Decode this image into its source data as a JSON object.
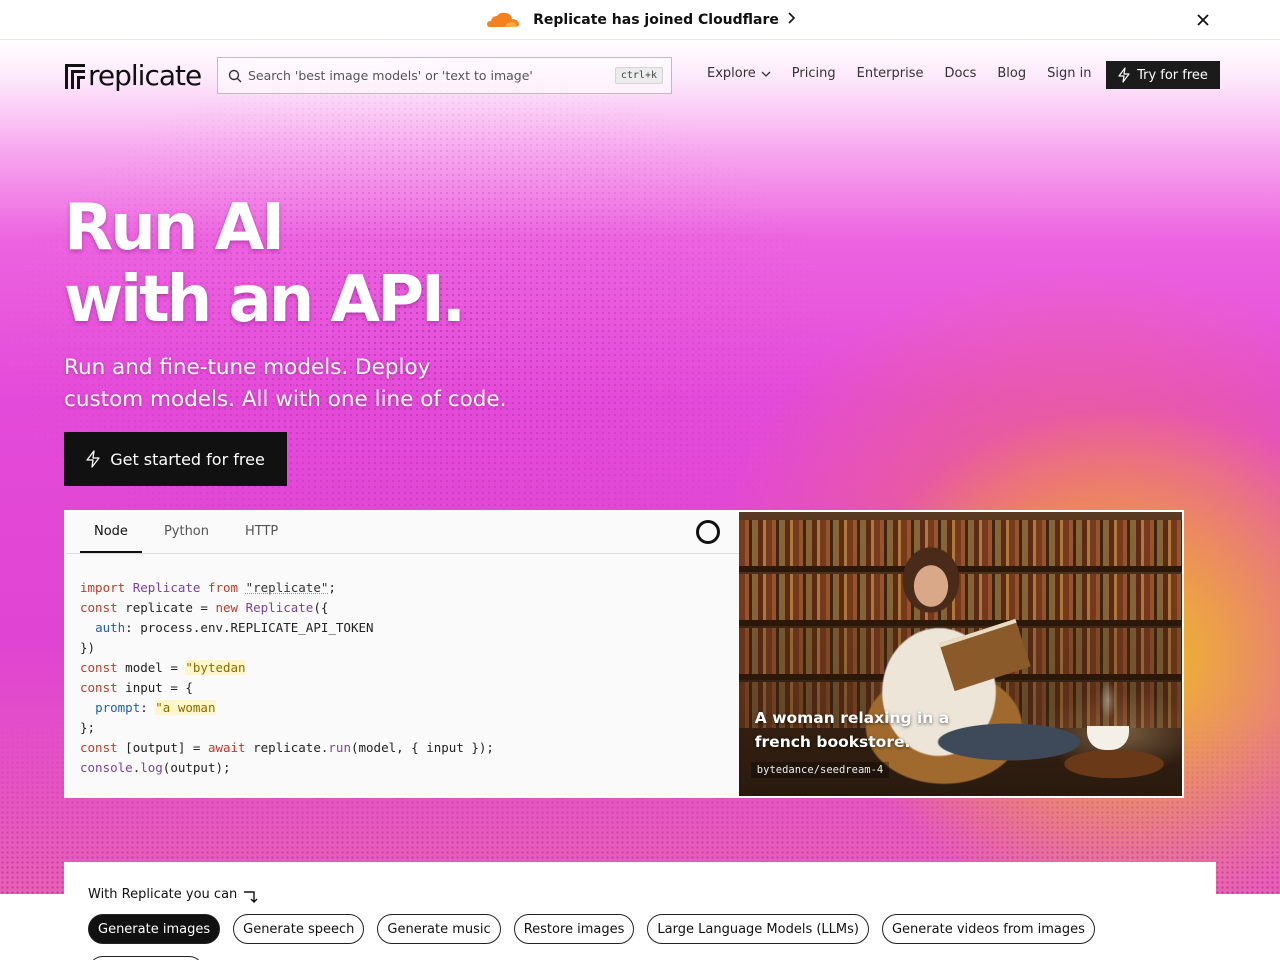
{
  "announcement": {
    "text": "Replicate has joined Cloudflare",
    "brand_color": "#f48120"
  },
  "nav": {
    "logo_text": "replicate",
    "search": {
      "placeholder": "Search 'best image models' or 'text to image'",
      "shortcut": "ctrl+k"
    },
    "links": [
      "Explore",
      "Pricing",
      "Enterprise",
      "Docs",
      "Blog",
      "Sign in"
    ],
    "try_label": "Try for free"
  },
  "hero": {
    "title_line1": "Run AI",
    "title_line2": "with an API.",
    "subtitle_line1": "Run and fine-tune models. Deploy",
    "subtitle_line2": "custom models. All with one line of code.",
    "cta_label": "Get started for free"
  },
  "code_panel": {
    "tabs": [
      "Node",
      "Python",
      "HTTP"
    ],
    "active_tab": "Node",
    "lines": {
      "l1_kw": "import",
      "l1_cls": "Replicate",
      "l1_from": "from",
      "l1_str": "\"replicate\"",
      "l1_end": ";",
      "l2_kw": "const",
      "l2_var": " replicate = ",
      "l2_new": "new",
      "l2_cls": "Replicate",
      "l2_end": "({",
      "l3_prop": "auth",
      "l3_rest": ": process.env.REPLICATE_API_TOKEN",
      "l4": "})",
      "l5_kw": "const",
      "l5_var": " model = ",
      "l5_str": "\"bytedan",
      "l6_kw": "const",
      "l6_var": " input = {",
      "l7_prop": "prompt",
      "l7_colon": ": ",
      "l7_str": "\"a woman",
      "l8": "};",
      "l9_kw": "const",
      "l9_var": " [output] = ",
      "l9_await": "await",
      "l9_mid": " replicate.",
      "l9_fn": "run",
      "l9_end": "(model, { input });",
      "l10_obj": "console",
      "l10_dot": ".",
      "l10_fn": "log",
      "l10_end": "(output);"
    }
  },
  "demo_image": {
    "caption": "A woman relaxing in a french bookstore.",
    "model": "bytedance/seedream-4"
  },
  "capabilities": {
    "lead": "With Replicate you can",
    "chips": [
      "Generate images",
      "Generate speech",
      "Generate music",
      "Restore images",
      "Large Language Models (LLMs)",
      "Generate videos from images"
    ],
    "active_chip": "Generate images"
  }
}
